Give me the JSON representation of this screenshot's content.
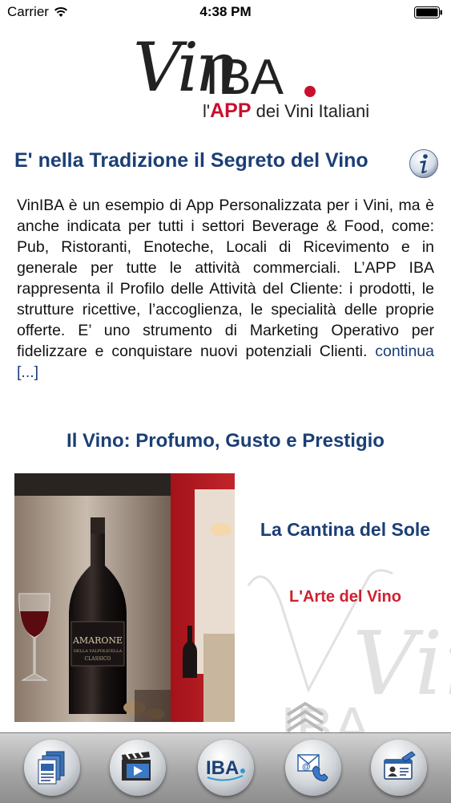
{
  "status_bar": {
    "carrier": "Carrier",
    "time": "4:38 PM"
  },
  "logo": {
    "vin": "Vin",
    "iba": "IBA",
    "dot": ".",
    "sub_prefix": "l'",
    "sub_app": "APP",
    "sub_rest": " dei Vini Italiani"
  },
  "section1": {
    "title": "E' nella Tradizione il Segreto del Vino",
    "body": "VinIBA è un esempio di App Personalizzata per i Vini, ma è anche indicata per tutti i settori Beverage & Food, come: Pub, Ristoranti, Enoteche, Locali di Ricevimento e in generale per tutte le attività commerciali. L’APP IBA rappresenta il Profilo delle Attività del Cliente: i prodotti, le strutture ricettive, l’accoglienza, le specialità delle proprie offerte. E’ uno strumento di Marketing Operativo per fidelizzare e conquistare nuovi potenziali Clienti.",
    "more_link": "continua [...]"
  },
  "section2": {
    "title": "Il Vino: Profumo, Gusto e Prestigio",
    "feature_title": "La Cantina del Sole",
    "feature_subtitle": "L'Arte del Vino",
    "bottle_label": "AMARONE",
    "bottle_sub": "DELLA VALPOLICELLA",
    "bottle_classico": "CLASSICO"
  },
  "watermark": {
    "text": "Vin",
    "iba": "IBA"
  },
  "tab_bar": {
    "items": [
      {
        "icon": "document-icon"
      },
      {
        "icon": "video-icon"
      },
      {
        "icon": "iba-logo-icon",
        "label": "IBA"
      },
      {
        "icon": "contact-mail-icon"
      },
      {
        "icon": "id-card-icon"
      }
    ]
  }
}
